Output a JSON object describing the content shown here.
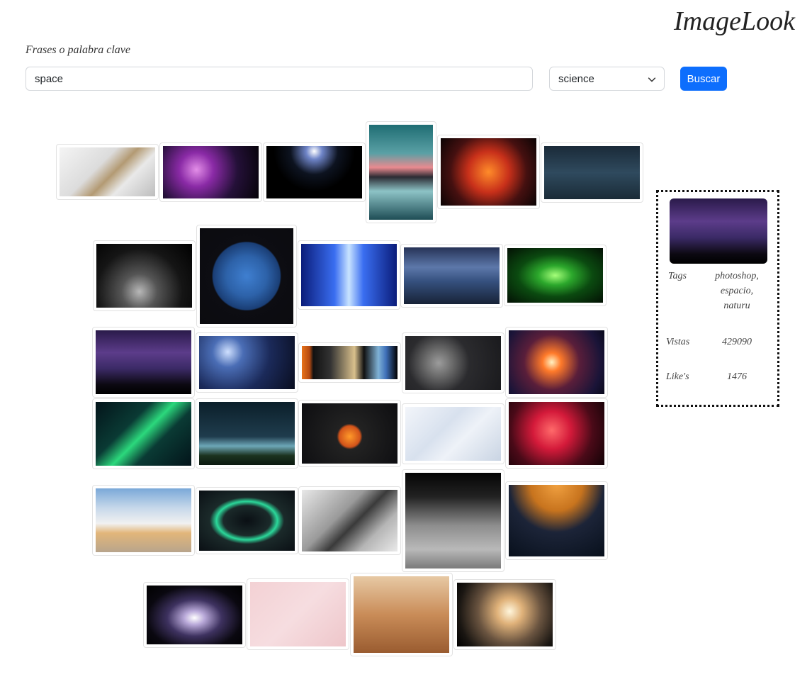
{
  "header": {
    "brand": "ImageLook"
  },
  "search": {
    "label": "Frases o palabra clave",
    "value": "space"
  },
  "category": {
    "selected": "science"
  },
  "button": {
    "label": "Buscar"
  },
  "accent_color": "#0d6efd",
  "gallery": {
    "images": [
      "laptop-envelope",
      "purple-nebula",
      "planet-horizon",
      "astronaut-reflection",
      "orange-nebula",
      "dark-mountains",
      "moon-landscape-bw",
      "earth",
      "space-runner",
      "blue-mountains",
      "green-grid",
      "milky-way-tree",
      "blue-galaxy",
      "solar-system-planets",
      "moon-and-planet",
      "earth-sunrise",
      "green-aurora",
      "ufo-beam",
      "solar-system-orbits",
      "white-paper-texture",
      "red-nebula",
      "shuttle-launch",
      "neon-tunnel",
      "laptop-grey",
      "apollo-astronaut",
      "orange-planet-ship",
      "spiral-galaxy",
      "pink-desk-setup",
      "mars-rover",
      "rocket-smoke"
    ]
  },
  "detail": {
    "tags_label": "Tags",
    "tags_value": "photoshop, espacio, naturu",
    "views_label": "Vistas",
    "views_value": "429090",
    "likes_label": "Like's",
    "likes_value": "1476"
  }
}
